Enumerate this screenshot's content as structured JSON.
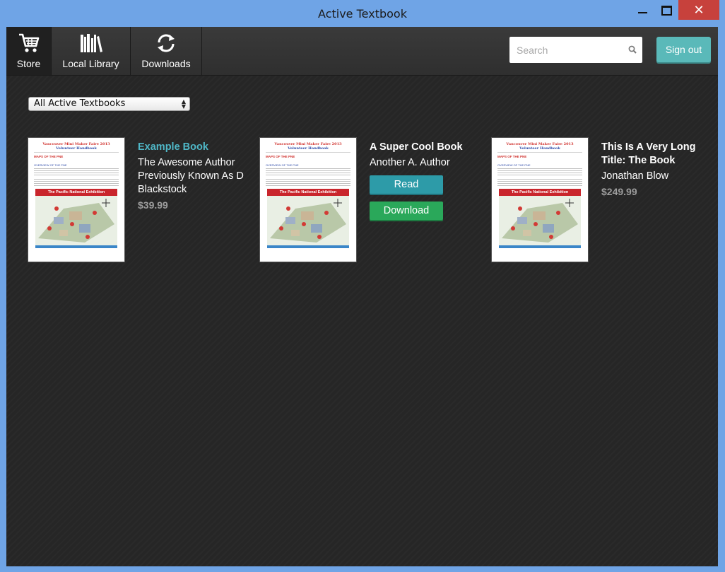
{
  "window": {
    "title": "Active Textbook",
    "close_glyph": "✕"
  },
  "toolbar": {
    "nav": [
      {
        "label": "Store",
        "icon": "cart-icon"
      },
      {
        "label": "Local Library",
        "icon": "books-icon"
      },
      {
        "label": "Downloads",
        "icon": "refresh-icon"
      }
    ],
    "search_placeholder": "Search",
    "signout_label": "Sign out"
  },
  "filter": {
    "selected": "All Active Textbooks"
  },
  "cover": {
    "line1": "Vancouver Mini Maker Faire 2013",
    "line2": "Volunteer Handbook",
    "section": "MAPS OF THE PNE",
    "subsection": "OVERVIEW OF THE PNE",
    "banner": "The Pacific National Exhibition"
  },
  "books": [
    {
      "title": "Example Book",
      "author": "The Awesome Author Previously Known As D Blackstock",
      "price": "$39.99"
    },
    {
      "title": "A Super Cool Book",
      "author": "Another A. Author",
      "read_label": "Read",
      "download_label": "Download"
    },
    {
      "title": "This Is A Very Long Title: The Book",
      "author": "Jonathan Blow",
      "price": "$249.99"
    }
  ],
  "colors": {
    "accent_teal": "#5ab9b9",
    "link_teal": "#4fb7c7",
    "download_green": "#2aa85a",
    "close_red": "#c7413c",
    "window_blue": "#6fa4e6"
  }
}
